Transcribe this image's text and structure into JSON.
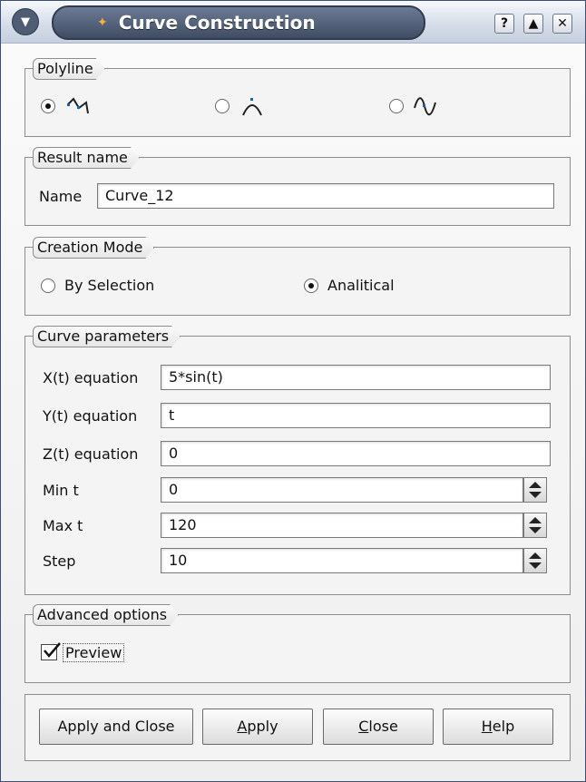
{
  "window": {
    "title": "Curve Construction",
    "help_glyph": "?",
    "shade_glyph": "▲",
    "close_glyph": "✕"
  },
  "polyline": {
    "legend": "Polyline",
    "options": [
      {
        "icon": "polyline-icon",
        "selected": true
      },
      {
        "icon": "arc-icon",
        "selected": false
      },
      {
        "icon": "spline-icon",
        "selected": false
      }
    ]
  },
  "result": {
    "legend": "Result name",
    "name_label": "Name",
    "name_value": "Curve_12"
  },
  "creation_mode": {
    "legend": "Creation Mode",
    "options": [
      {
        "label": "By Selection",
        "selected": false
      },
      {
        "label": "Analitical",
        "selected": true
      }
    ]
  },
  "curve_params": {
    "legend": "Curve parameters",
    "x_label": "X(t) equation",
    "x_value": "5*sin(t)",
    "y_label": "Y(t) equation",
    "y_value": "t",
    "z_label": "Z(t) equation",
    "z_value": "0",
    "min_label": "Min t",
    "min_value": "0",
    "max_label": "Max t",
    "max_value": "120",
    "step_label": "Step",
    "step_value": "10"
  },
  "advanced": {
    "legend": "Advanced options",
    "preview_label": "Preview",
    "preview_checked": true
  },
  "buttons": {
    "apply_close": "Apply and Close",
    "apply_first": "A",
    "apply_rest": "pply",
    "close_first": "C",
    "close_rest": "lose",
    "help_first": "H",
    "help_rest": "elp"
  }
}
